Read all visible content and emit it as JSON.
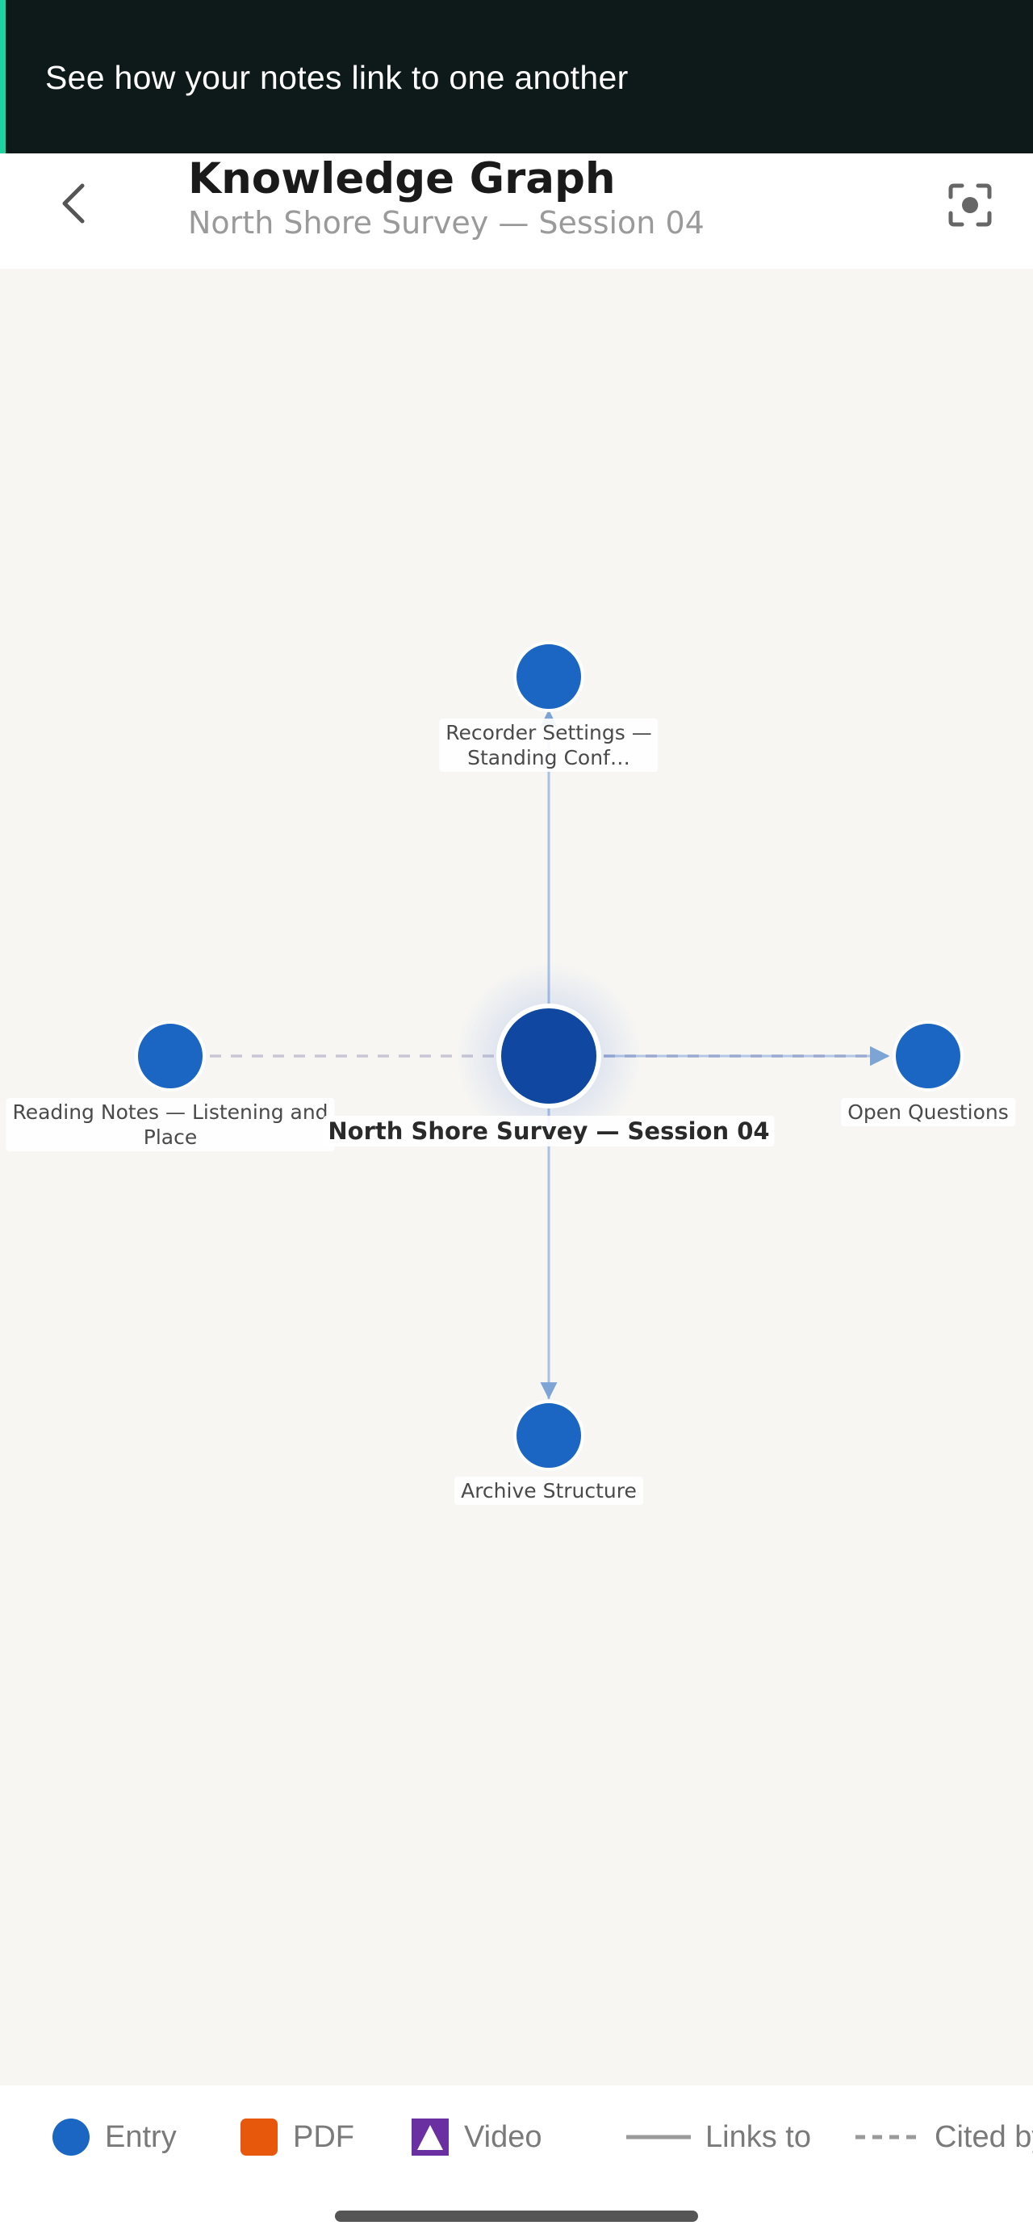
{
  "banner": {
    "text": "See how your notes link to one another",
    "accent_color": "#1fd4a0"
  },
  "header": {
    "title": "Knowledge Graph",
    "subtitle": "North Shore Survey — Session 04",
    "back_icon": "chevron-left-icon",
    "focus_icon": "focus-target-icon"
  },
  "graph": {
    "center": {
      "label": "North Shore Survey — Session 04",
      "type": "entry"
    },
    "nodes": [
      {
        "id": "top",
        "label_lines": [
          "Recorder Settings —",
          "Standing Conf…"
        ],
        "type": "entry"
      },
      {
        "id": "left",
        "label_lines": [
          "Reading Notes — Listening and",
          "Place"
        ],
        "type": "entry"
      },
      {
        "id": "right",
        "label_lines": [
          "Open Questions"
        ],
        "type": "entry"
      },
      {
        "id": "bottom",
        "label_lines": [
          "Archive Structure"
        ],
        "type": "entry"
      }
    ],
    "edges": [
      {
        "from": "center",
        "to": "top",
        "kind": "links_to"
      },
      {
        "from": "center",
        "to": "bottom",
        "kind": "links_to"
      },
      {
        "from": "center",
        "to": "right",
        "kind": "links_to"
      },
      {
        "from": "center",
        "to": "right",
        "kind": "cited_by"
      },
      {
        "from": "left",
        "to": "center",
        "kind": "cited_by"
      }
    ],
    "colors": {
      "entry": "#1a66c2",
      "center": "#0f47a1",
      "link": "#9bb9e0",
      "cited": "#b8bfd6"
    }
  },
  "legend": {
    "entry": {
      "label": "Entry",
      "color": "#1a66c2"
    },
    "pdf": {
      "label": "PDF",
      "color": "#e8580c"
    },
    "video": {
      "label": "Video",
      "color": "#6a2fa0"
    },
    "links_to": {
      "label": "Links to"
    },
    "cited_by": {
      "label": "Cited by"
    }
  }
}
